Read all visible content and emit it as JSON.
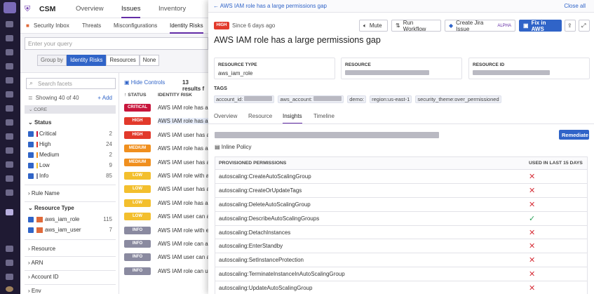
{
  "app": {
    "name": "CSM",
    "nav": [
      "Overview",
      "Issues",
      "Inventory"
    ]
  },
  "subnav": [
    "Security Inbox",
    "Threats",
    "Misconfigurations",
    "Identity Risks"
  ],
  "query": {
    "placeholder": "Enter your query"
  },
  "groupby": {
    "label": "Group by",
    "options": [
      "Identity Risks",
      "Resources",
      "None"
    ],
    "selected": "Identity Risks"
  },
  "facets": {
    "search_placeholder": "Search facets",
    "showing": "Showing 40 of 40",
    "add": "Add",
    "core": "CORE",
    "status_title": "Status",
    "status": [
      {
        "label": "Critical",
        "count": "2",
        "color": "#c8163c"
      },
      {
        "label": "High",
        "count": "24",
        "color": "#e2392b"
      },
      {
        "label": "Medium",
        "count": "2",
        "color": "#f08f1e"
      },
      {
        "label": "Low",
        "count": "9",
        "color": "#f3bf2d"
      },
      {
        "label": "Info",
        "count": "85",
        "color": "#8a8aa0"
      }
    ],
    "rule_name": "Rule Name",
    "resource_type": "Resource Type",
    "resource_types": [
      {
        "label": "aws_iam_role",
        "count": "115"
      },
      {
        "label": "aws_iam_user",
        "count": "7"
      }
    ],
    "others": [
      "Resource",
      "ARN",
      "Account ID",
      "Env"
    ]
  },
  "list": {
    "hide_controls": "Hide Controls",
    "results": "13 results f",
    "col_status": "STATUS",
    "col_risk": "IDENTITY RISK",
    "rows": [
      {
        "badge": "CRITICAL",
        "color": "#c8163c",
        "text": "AWS IAM role has a t"
      },
      {
        "badge": "HIGH",
        "color": "#e2392b",
        "text": "AWS IAM role has a la"
      },
      {
        "badge": "HIGH",
        "color": "#e2392b",
        "text": "AWS IAM user has a l"
      },
      {
        "badge": "MEDIUM",
        "color": "#f08f1e",
        "text": "AWS IAM role has acc"
      },
      {
        "badge": "MEDIUM",
        "color": "#f08f1e",
        "text": "AWS IAM user has acc"
      },
      {
        "badge": "LOW",
        "color": "#f3bf2d",
        "text": "AWS IAM role with ad"
      },
      {
        "badge": "LOW",
        "color": "#f3bf2d",
        "text": "AWS IAM user has adr"
      },
      {
        "badge": "LOW",
        "color": "#f3bf2d",
        "text": "AWS IAM role has adr"
      },
      {
        "badge": "LOW",
        "color": "#f3bf2d",
        "text": "AWS IAM user can ass"
      },
      {
        "badge": "INFO",
        "color": "#8a8aa0",
        "text": "AWS IAM role with ex"
      },
      {
        "badge": "INFO",
        "color": "#8a8aa0",
        "text": "AWS IAM role can ass"
      },
      {
        "badge": "INFO",
        "color": "#8a8aa0",
        "text": "AWS IAM user can ass"
      },
      {
        "badge": "INFO",
        "color": "#8a8aa0",
        "text": "AWS IAM role can upo"
      }
    ]
  },
  "panel": {
    "back_title": "AWS IAM role has a large permissions gap",
    "close": "Close all",
    "severity": "HIGH",
    "since": "Since 6 days ago",
    "title": "AWS IAM role has a large permissions gap",
    "buttons": {
      "mute": "Mute",
      "workflow": "Run Workflow",
      "jira": "Create Jira Issue",
      "jira_badge": "ALPHA",
      "fix": "Fix in AWS"
    },
    "resource_type_label": "RESOURCE TYPE",
    "resource_type": "aws_iam_role",
    "resource_label": "RESOURCE",
    "resource_id_label": "RESOURCE ID",
    "tags_label": "TAGS",
    "tags": [
      "account_id:",
      "aws_account:",
      "demo:",
      "region:us-east-1",
      "security_theme:over_permissioned"
    ],
    "tabs": [
      "Overview",
      "Resource",
      "Insights",
      "Timeline"
    ],
    "active_tab": "Insights",
    "remediate": "Remediate",
    "inline_policy": "Inline Policy",
    "col_perm": "PROVISIONED PERMISSIONS",
    "col_used": "USED IN LAST 15 DAYS",
    "permissions": [
      {
        "name": "autoscaling:CreateAutoScalingGroup",
        "used": "✕",
        "color": "#d6303a"
      },
      {
        "name": "autoscaling:CreateOrUpdateTags",
        "used": "✕",
        "color": "#d6303a"
      },
      {
        "name": "autoscaling:DeleteAutoScalingGroup",
        "used": "✕",
        "color": "#d6303a"
      },
      {
        "name": "autoscaling:DescribeAutoScalingGroups",
        "used": "✓",
        "color": "#2ca35a"
      },
      {
        "name": "autoscaling:DetachInstances",
        "used": "✕",
        "color": "#d6303a"
      },
      {
        "name": "autoscaling:EnterStandby",
        "used": "✕",
        "color": "#d6303a"
      },
      {
        "name": "autoscaling:SetInstanceProtection",
        "used": "✕",
        "color": "#d6303a"
      },
      {
        "name": "autoscaling:TerminateInstanceInAutoScalingGroup",
        "used": "✕",
        "color": "#d6303a"
      },
      {
        "name": "autoscaling:UpdateAutoScalingGroup",
        "used": "✕",
        "color": "#d6303a"
      }
    ]
  }
}
